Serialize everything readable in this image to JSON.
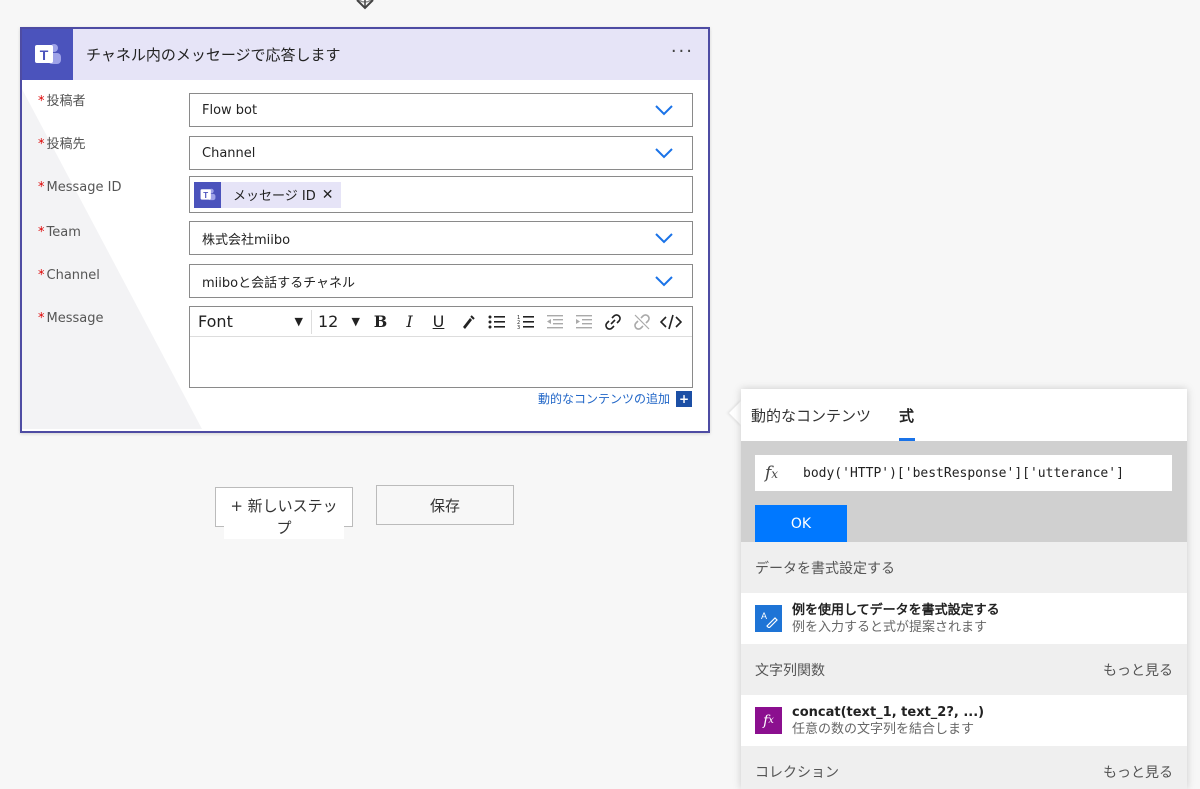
{
  "card": {
    "title": "チャネル内のメッセージで応答します",
    "menu": "···",
    "fields": [
      {
        "label": "投稿者",
        "value": "Flow bot",
        "type": "dropdown"
      },
      {
        "label": "投稿先",
        "value": "Channel",
        "type": "dropdown"
      },
      {
        "label": "Message ID",
        "token": "メッセージ ID",
        "type": "token"
      },
      {
        "label": "Team",
        "value": "株式会社miibo",
        "type": "dropdown"
      },
      {
        "label": "Channel",
        "value": "miiboと会話するチャネル",
        "type": "dropdown"
      },
      {
        "label": "Message",
        "type": "richtext"
      }
    ],
    "editor": {
      "font": "Font",
      "size": "12",
      "bold": "B",
      "italic": "I",
      "underline": "U"
    },
    "add_dynamic": "動的なコンテンツの追加",
    "add_dynamic_plus": "+"
  },
  "buttons": {
    "new_step": "+ 新しいステップ",
    "save": "保存"
  },
  "panel": {
    "tabs": [
      "動的なコンテンツ",
      "式"
    ],
    "active_tab": 1,
    "expression": "body('HTTP')['bestResponse']['utterance']",
    "fx": "fx",
    "ok": "OK",
    "sections": [
      {
        "title": "データを書式設定する",
        "more": "",
        "item": {
          "icon": "format-data-icon",
          "title": "例を使用してデータを書式設定する",
          "desc": "例を入力すると式が提案されます"
        }
      },
      {
        "title": "文字列関数",
        "more": "もっと見る",
        "item": {
          "icon": "function-icon",
          "title": "concat(text_1, text_2?, ...)",
          "desc": "任意の数の文字列を結合します"
        }
      },
      {
        "title": "コレクション",
        "more": "もっと見る"
      }
    ]
  },
  "colors": {
    "card_border": "#4e4ca3",
    "header_bg": "#e6e4f7",
    "teams_purple": "#4b53bc",
    "link_blue": "#2166c7",
    "ok_blue": "#0078ff",
    "concat_purple": "#8b0f8f"
  }
}
